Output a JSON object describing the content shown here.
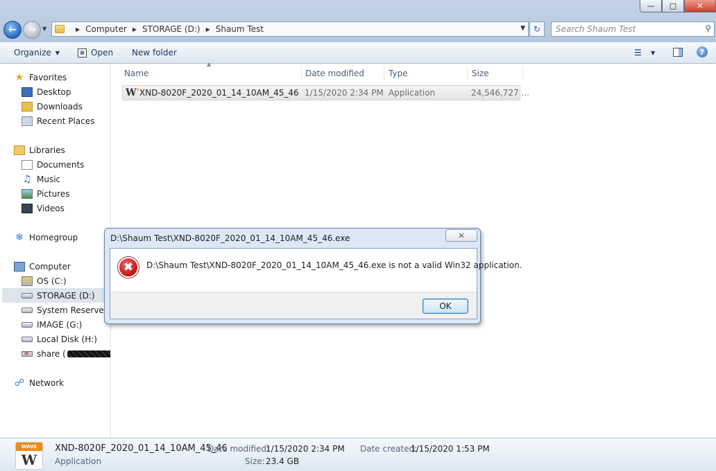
{
  "window": {
    "minimize_glyph": "—",
    "maximize_glyph": "□",
    "close_glyph": "✕"
  },
  "address": {
    "crumbs": [
      "Computer",
      "STORAGE (D:)",
      "Shaum Test"
    ]
  },
  "search": {
    "placeholder": "Search Shaum Test"
  },
  "toolbar": {
    "organize_label": "Organize",
    "open_label": "Open",
    "new_folder_label": "New folder"
  },
  "sidebar": {
    "favorites": "Favorites",
    "desktop": "Desktop",
    "downloads": "Downloads",
    "recent_places": "Recent Places",
    "libraries": "Libraries",
    "documents": "Documents",
    "music": "Music",
    "pictures": "Pictures",
    "videos": "Videos",
    "homegroup": "Homegroup",
    "computer": "Computer",
    "os_c": "OS (C:)",
    "storage_d": "STORAGE (D:)",
    "system_reserved": "System Reserved (F",
    "image_g": "IMAGE (G:)",
    "local_disk_h": "Local Disk (H:)",
    "share": "share (",
    "network": "Network"
  },
  "columns": {
    "name": "Name",
    "date_modified": "Date modified",
    "type": "Type",
    "size": "Size"
  },
  "files": [
    {
      "name": "XND-8020F_2020_01_14_10AM_45_46",
      "date_modified": "1/15/2020 2:34 PM",
      "type": "Application",
      "size": "24,546,727 ..."
    }
  ],
  "dialog": {
    "title": "D:\\Shaum Test\\XND-8020F_2020_01_14_10AM_45_46.exe",
    "message": "D:\\Shaum Test\\XND-8020F_2020_01_14_10AM_45_46.exe is not a valid Win32 application.",
    "ok_label": "OK",
    "close_glyph": "✕"
  },
  "details": {
    "icon_banner": "WAVE",
    "name": "XND-8020F_2020_01_14_10AM_45_46",
    "type": "Application",
    "date_modified_label": "Date modified:",
    "date_modified": "1/15/2020 2:34 PM",
    "size_label": "Size:",
    "size": "23.4 GB",
    "date_created_label": "Date created:",
    "date_created": "1/15/2020 1:53 PM"
  }
}
